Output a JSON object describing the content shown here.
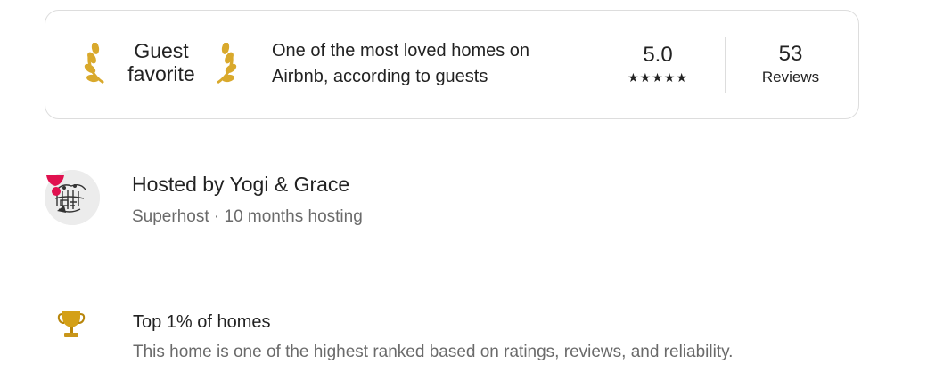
{
  "guest_favorite": {
    "badge_line1": "Guest",
    "badge_line2": "favorite",
    "description_line1": "One of the most loved homes on",
    "description_line2": "Airbnb, according to guests",
    "rating": "5.0",
    "stars": "★★★★★",
    "star_count": 5,
    "reviews_count": "53",
    "reviews_label": "Reviews",
    "laurel_color": "#d9a92c"
  },
  "host": {
    "name": "Hosted by Yogi & Grace",
    "meta": "Superhost · 10 months hosting",
    "superhost_badge_color": "#e0114f",
    "avatar_icon": "host-avatar-illustration"
  },
  "highlight": {
    "icon": "trophy-icon",
    "icon_color": "#d4a017",
    "title": "Top 1% of homes",
    "description": "This home is one of the highest ranked based on ratings, reviews, and reliability."
  }
}
